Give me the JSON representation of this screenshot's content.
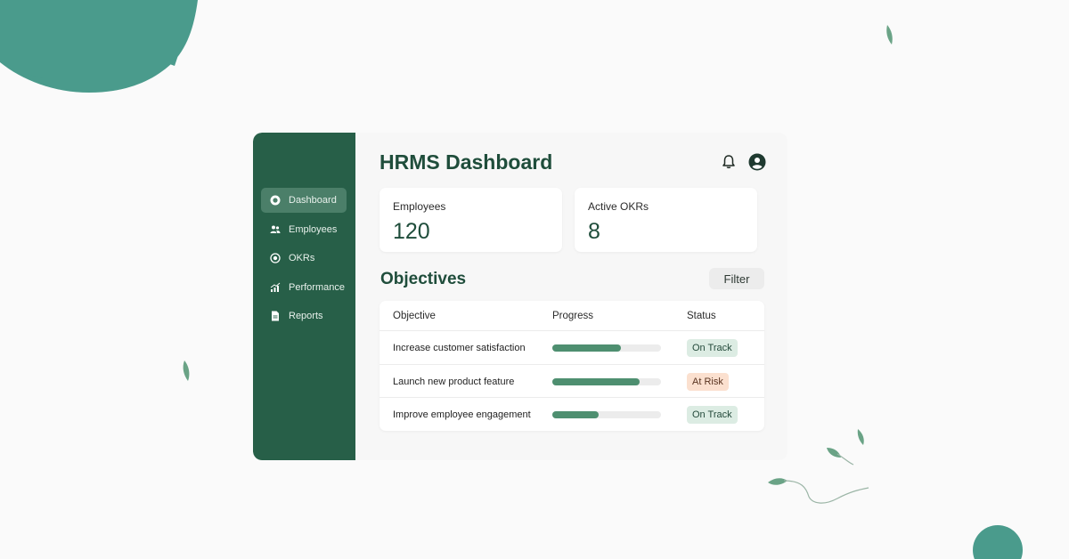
{
  "app": {
    "title": "HRMS Dashboard"
  },
  "sidebar": {
    "items": [
      {
        "label": "Dashboard",
        "icon": "dashboard-icon",
        "active": true
      },
      {
        "label": "Employees",
        "icon": "users-icon",
        "active": false
      },
      {
        "label": "OKRs",
        "icon": "target-icon",
        "active": false
      },
      {
        "label": "Performance",
        "icon": "chart-icon",
        "active": false
      },
      {
        "label": "Reports",
        "icon": "document-icon",
        "active": false
      }
    ]
  },
  "header": {
    "icons": [
      "bell-icon",
      "user-account-icon"
    ]
  },
  "stats": [
    {
      "label": "Employees",
      "value": "120"
    },
    {
      "label": "Active OKRs",
      "value": "8"
    }
  ],
  "objectives": {
    "title": "Objectives",
    "filter_label": "Filter",
    "columns": [
      "Objective",
      "Progress",
      "Status"
    ],
    "rows": [
      {
        "objective": "Increase customer satisfaction",
        "progress": 0.63,
        "status": "On Track",
        "status_type": "on-track"
      },
      {
        "objective": "Launch new product feature",
        "progress": 0.8,
        "status": "At Risk",
        "status_type": "at-risk"
      },
      {
        "objective": "Improve employee engagement",
        "progress": 0.43,
        "status": "On Track",
        "status_type": "on-track"
      }
    ]
  },
  "colors": {
    "sidebar": "#275f48",
    "accent": "#4e8f70",
    "decor": "#4a9b8c",
    "title": "#1f4d3b"
  }
}
